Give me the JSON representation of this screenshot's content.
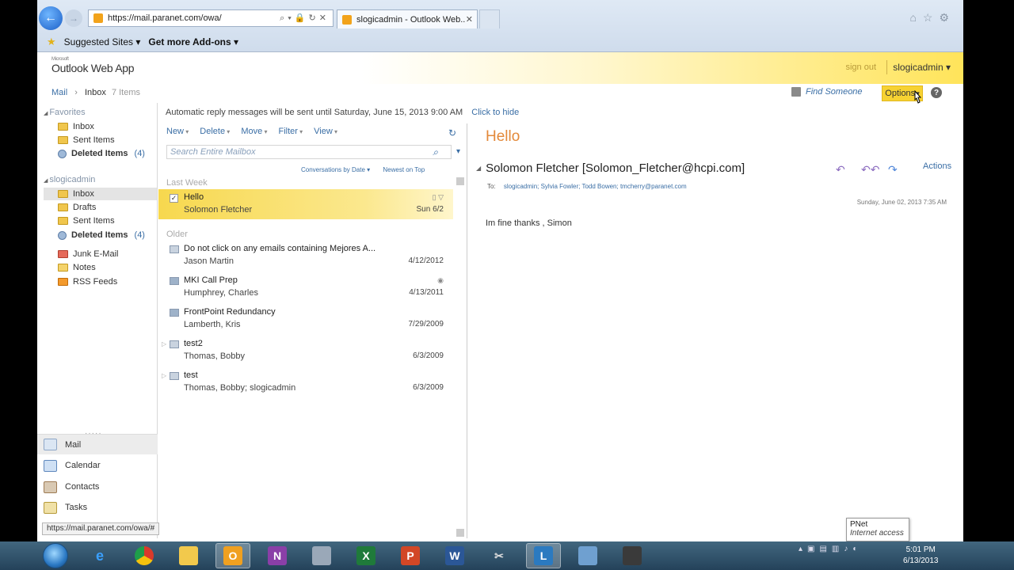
{
  "browser": {
    "url": "https://mail.paranet.com/owa/",
    "tab_title": "slogicadmin - Outlook Web...",
    "favorites_bar": {
      "suggested": "Suggested Sites",
      "addons": "Get more Add-ons"
    },
    "status_url": "https://mail.paranet.com/owa/#",
    "tooltip": {
      "title": "PNet",
      "subtitle": "Internet access"
    }
  },
  "header": {
    "logo_small": "Microsoft",
    "logo": "Outlook Web App",
    "sign_out": "sign out",
    "user": "slogicadmin"
  },
  "breadcrumb": {
    "mail": "Mail",
    "folder": "Inbox",
    "count": "7 Items"
  },
  "top_actions": {
    "find_someone": "Find Someone",
    "options": "Options"
  },
  "leftnav": {
    "favorites_label": "Favorites",
    "favorites": [
      {
        "label": "Inbox",
        "icon": "folder-icon"
      },
      {
        "label": "Sent Items",
        "icon": "folder-icon"
      },
      {
        "label": "Deleted Items",
        "count": "(4)",
        "bold": true,
        "icon": "deleted-items-icon"
      }
    ],
    "mailbox_label": "slogicadmin",
    "mailbox": [
      {
        "label": "Inbox",
        "selected": true,
        "icon": "folder-icon"
      },
      {
        "label": "Drafts",
        "icon": "folder-icon"
      },
      {
        "label": "Sent Items",
        "icon": "folder-icon"
      },
      {
        "label": "Deleted Items",
        "count": "(4)",
        "bold": true,
        "icon": "deleted-items-icon"
      },
      {
        "label": "Junk E-Mail",
        "icon": "junk-folder-icon"
      },
      {
        "label": "Notes",
        "icon": "notes-folder-icon"
      },
      {
        "label": "RSS Feeds",
        "icon": "rss-folder-icon"
      }
    ],
    "modules": [
      "Mail",
      "Calendar",
      "Contacts",
      "Tasks"
    ]
  },
  "banner": {
    "text": "Automatic reply messages will be sent until Saturday, June 15, 2013 9:00 AM",
    "link": "Click to hide"
  },
  "list": {
    "toolbar": [
      "New",
      "Delete",
      "Move",
      "Filter",
      "View"
    ],
    "search_placeholder": "Search Entire Mailbox",
    "sort_conversations": "Conversations by Date ▾",
    "sort_order": "Newest on Top",
    "groups": {
      "last_week": "Last Week",
      "older": "Older"
    },
    "messages": [
      {
        "subject": "Hello",
        "sender": "Solomon Fletcher",
        "date": "Sun 6/2",
        "selected": true
      },
      {
        "subject": "Do not click on any emails containing Mejores A...",
        "sender": "Jason Martin",
        "date": "4/12/2012"
      },
      {
        "subject": "MKI Call Prep",
        "sender": "Humphrey, Charles",
        "date": "4/13/2011"
      },
      {
        "subject": "FrontPoint Redundancy",
        "sender": "Lamberth, Kris",
        "date": "7/29/2009"
      },
      {
        "subject": "test2",
        "sender": "Thomas, Bobby",
        "date": "6/3/2009"
      },
      {
        "subject": "test",
        "sender": "Thomas, Bobby; slogicadmin",
        "date": "6/3/2009"
      }
    ]
  },
  "reading": {
    "subject": "Hello",
    "from": "Solomon Fletcher [Solomon_Fletcher@hcpi.com]",
    "actions": "Actions",
    "to_label": "To:",
    "to": "slogicadmin; Sylvia Fowler; Todd Bowen; tmcherry@paranet.com",
    "date": "Sunday, June 02, 2013 7:35 AM",
    "body": "Im fine thanks , Simon"
  },
  "taskbar": {
    "time": "5:01 PM",
    "date": "6/13/2013"
  },
  "colors": {
    "accent_yellow": "#f7d232",
    "link_blue": "#3a6ea5",
    "subject_orange": "#e3893a"
  }
}
